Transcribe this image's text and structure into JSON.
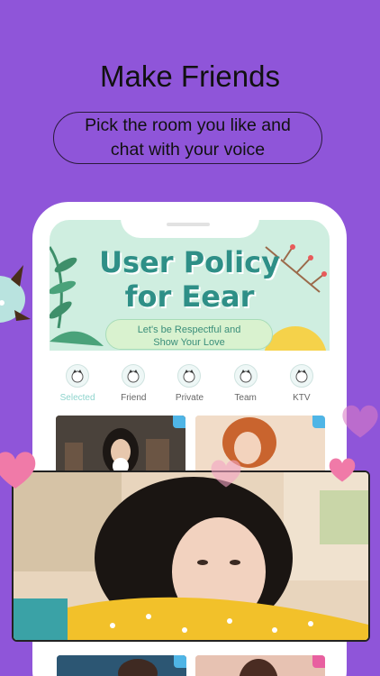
{
  "header": {
    "title": "Make Friends",
    "subtitle": "Pick the room you like and chat with your voice"
  },
  "banner": {
    "title_line1": "User Policy",
    "title_line2": "for Eear",
    "sub_line1": "Let's be Respectful and",
    "sub_line2": "Show Your Love"
  },
  "categories": [
    {
      "label": "Selected",
      "icon": "cat-avatar-icon",
      "active": true
    },
    {
      "label": "Friend",
      "icon": "cat-avatar-icon",
      "active": false
    },
    {
      "label": "Private",
      "icon": "cat-avatar-icon",
      "active": false
    },
    {
      "label": "Team",
      "icon": "cat-avatar-icon",
      "active": false
    },
    {
      "label": "KTV",
      "icon": "cat-avatar-icon",
      "active": false
    }
  ],
  "colors": {
    "background": "#8f55d9",
    "banner_text": "#2e8f87",
    "selected_label": "#8ed4cd",
    "tag_blue": "#4fb5e6",
    "tag_pink": "#e860a0",
    "heart": "#f07aa8"
  },
  "rooms": [
    {
      "tag_icon": "bookmark-icon",
      "tag_color": "blue"
    },
    {
      "tag_icon": "search-icon",
      "tag_color": "blue"
    },
    {
      "tag_icon": "bookmark-icon",
      "tag_color": "blue"
    },
    {
      "tag_icon": "female-icon",
      "tag_color": "pink"
    }
  ]
}
